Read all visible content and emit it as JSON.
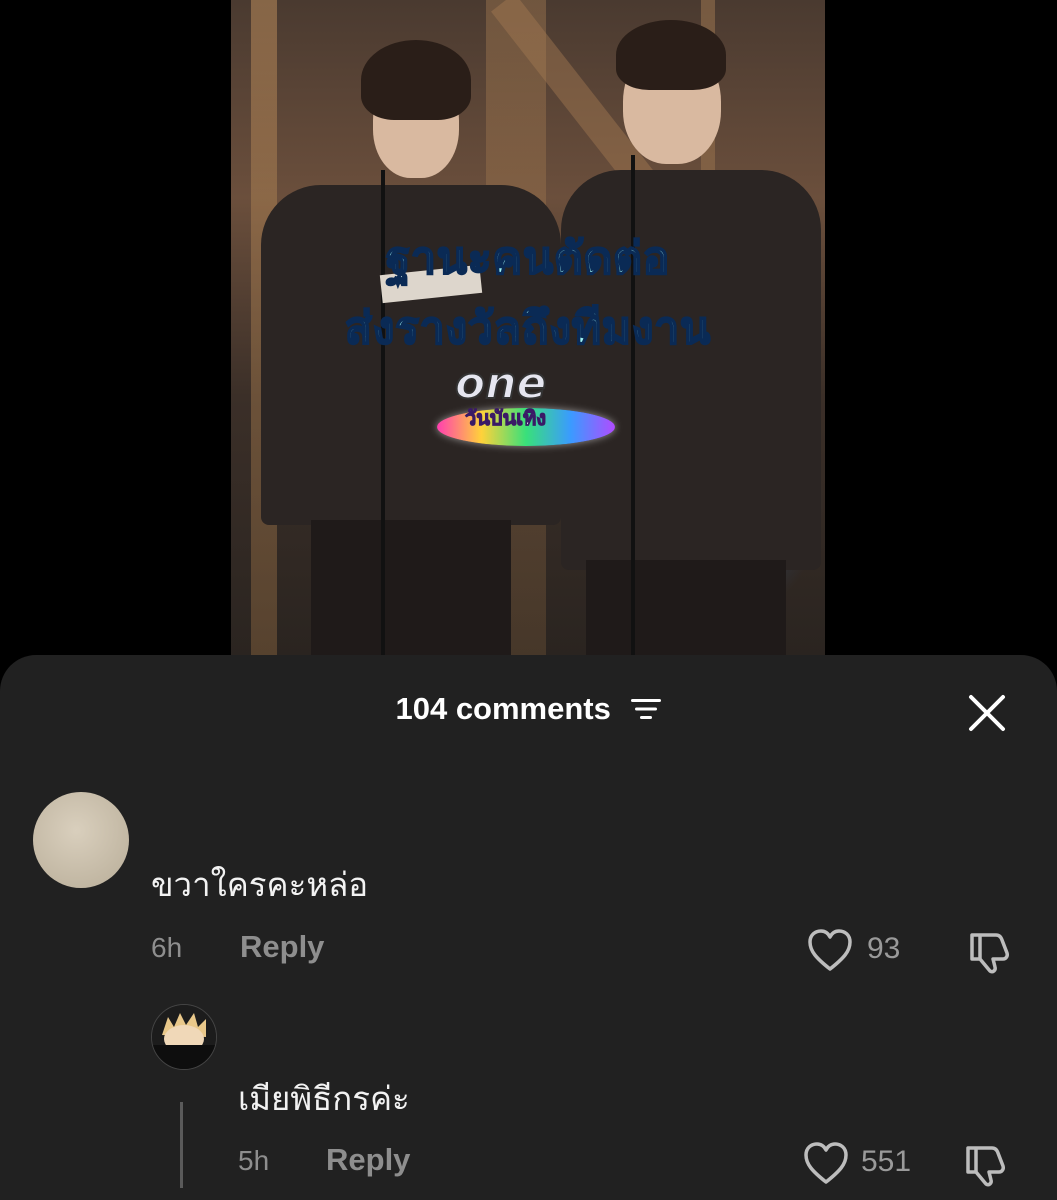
{
  "video": {
    "caption_line1": "ฐานะคนตัดต่อ",
    "caption_line2": "ส่งรางวัลถึงทีมงาน",
    "logo_word": "one",
    "logo_sub": "วันบันเทิง"
  },
  "comments_sheet": {
    "title": "104 comments",
    "sort_icon": "sort-lines-icon",
    "close_icon": "close-x-icon",
    "comments": [
      {
        "text": "ขวาใครคะหล่อ",
        "time": "6h",
        "reply_label": "Reply",
        "likes": "93"
      },
      {
        "text": "เมียพิธีกรค่ะ",
        "time": "5h",
        "reply_label": "Reply",
        "likes": "551"
      }
    ]
  },
  "colors": {
    "sheet_background": "#212121",
    "caption": "#9ef2f2",
    "muted_text": "#8e8e8e"
  }
}
